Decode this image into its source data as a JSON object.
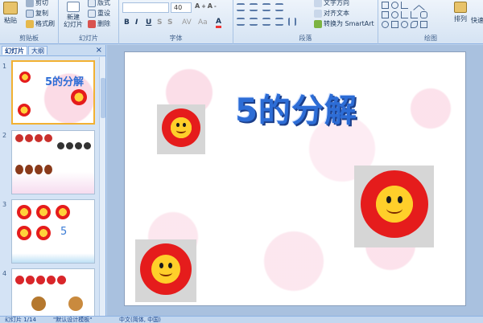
{
  "ribbon": {
    "clipboard": {
      "paste": "粘贴",
      "cut": "剪切",
      "copy": "复制",
      "format_painter": "格式刷",
      "label": "剪贴板"
    },
    "slides": {
      "new_slide": "新建\n幻灯片",
      "layout": "版式",
      "reset": "重设",
      "delete": "删除",
      "label": "幻灯片"
    },
    "font": {
      "font_size": "40",
      "bold": "B",
      "italic": "I",
      "underline": "U",
      "strike": "S",
      "label": "字体"
    },
    "paragraph": {
      "text_direction": "文字方向",
      "align_text": "对齐文本",
      "smartart": "转换为 SmartArt",
      "label": "段落"
    },
    "drawing": {
      "arrange": "排列",
      "quick_styles": "快速",
      "label": "绘图"
    }
  },
  "panel": {
    "tab_slides": "幻灯片",
    "tab_outline": "大纲",
    "close": "×",
    "thumbs": [
      {
        "num": "1",
        "title": "5的分解"
      },
      {
        "num": "2"
      },
      {
        "num": "3",
        "digit": "5"
      },
      {
        "num": "4"
      }
    ]
  },
  "slide": {
    "title": "5的分解"
  },
  "status": {
    "slide_count": "幻灯片 1/14",
    "theme": "\"默认设计模板\"",
    "language": "中文(简体, 中国)"
  },
  "colors": {
    "title_blue": "#2d6dd6",
    "petal_red": "#e51c1c",
    "face_yellow": "#ffcf2a",
    "selection": "#f2b132"
  }
}
